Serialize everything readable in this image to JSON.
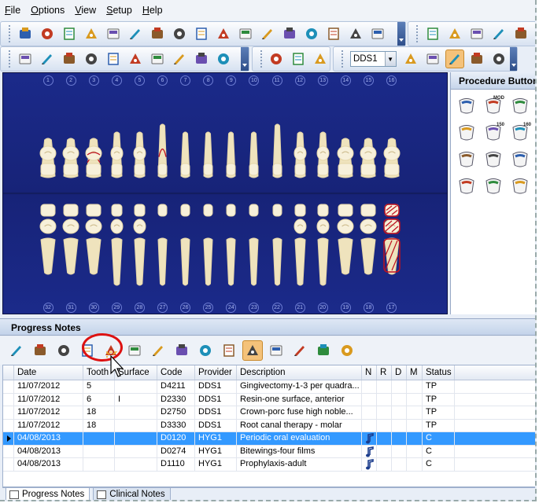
{
  "menu": [
    "File",
    "Options",
    "View",
    "Setup",
    "Help"
  ],
  "toolbar": {
    "provider": "DDS1"
  },
  "icons": {
    "row1": [
      "family-icon",
      "chart-icon",
      "book-icon",
      "chair-icon",
      "camera-icon",
      "pen-icon",
      "card-icon",
      "card2-icon",
      "clock-card-icon",
      "at-card-icon",
      "grid-icon",
      "cup-icon",
      "pencil-paper-icon",
      "door-icon",
      "dollar-icon",
      "glasses-icon",
      "xx-icon"
    ],
    "row1b": [
      "person-icon",
      "cross-icon",
      "medic-icon",
      "tablet-icon",
      "globe-icon"
    ],
    "row2": [
      "refresh-icon",
      "printer-icon",
      "fax-icon",
      "check-icon",
      "probe-icon",
      "syringe-icon",
      "xray-icon",
      "paper-icon",
      "loop-icon",
      "mouth-icon"
    ],
    "row2b": [
      "tooth-tool-icon",
      "implant-icon",
      "tooth-star-icon"
    ],
    "row2c": [
      "eo-icon",
      "ortho-icon",
      "tooth-active-icon",
      "check-circle-icon",
      "pane-icon"
    ]
  },
  "chart": {
    "upper_numbers": [
      "1",
      "2",
      "3",
      "4",
      "5",
      "6",
      "7",
      "8",
      "9",
      "10",
      "11",
      "12",
      "13",
      "14",
      "15",
      "16"
    ],
    "lower_numbers": [
      "32",
      "31",
      "30",
      "29",
      "28",
      "27",
      "26",
      "25",
      "24",
      "23",
      "22",
      "21",
      "20",
      "19",
      "18",
      "17"
    ],
    "accent": "#c0101e"
  },
  "procedure_panel": {
    "title": "Procedure Buttons",
    "buttons": [
      "crown-icon",
      "mod-icon",
      "onlay-icon",
      "endo-icon",
      "post-150-icon",
      "post-160-icon",
      "sealant-icon",
      "xray-pano-icon",
      "xray-bw-icon",
      "denture-upper-icon",
      "denture-lower-icon",
      "document-w-icon"
    ],
    "labels": [
      "MOD",
      "150",
      "160"
    ]
  },
  "progress_notes": {
    "title": "Progress Notes",
    "toolbar_icons": [
      "check-circle-icon",
      "trash-icon",
      "tools-icon",
      "printer-icon",
      "tooth-person-icon",
      "search-icon",
      "import-icon",
      "d-icon",
      "tick-icon",
      "e-icon",
      "tooth-active-icon",
      "phone-icon",
      "transfer-icon",
      "window-icon",
      "calculator-icon"
    ],
    "columns": [
      "Date",
      "Tooth",
      "Surface",
      "Code",
      "Provider",
      "Description",
      "N",
      "R",
      "D",
      "M",
      "Status"
    ],
    "rows": [
      {
        "date": "11/07/2012",
        "tooth": "5",
        "surface": "",
        "code": "D4211",
        "provider": "DDS1",
        "description": "Gingivectomy-1-3 per quadra...",
        "n": "",
        "status": "TP"
      },
      {
        "date": "11/07/2012",
        "tooth": "6",
        "surface": "I",
        "code": "D2330",
        "provider": "DDS1",
        "description": "Resin-one surface, anterior",
        "n": "",
        "status": "TP"
      },
      {
        "date": "11/07/2012",
        "tooth": "18",
        "surface": "",
        "code": "D2750",
        "provider": "DDS1",
        "description": "Crown-porc fuse high noble...",
        "n": "",
        "status": "TP"
      },
      {
        "date": "11/07/2012",
        "tooth": "18",
        "surface": "",
        "code": "D3330",
        "provider": "DDS1",
        "description": "Root canal therapy - molar",
        "n": "",
        "status": "TP"
      },
      {
        "date": "04/08/2013",
        "tooth": "",
        "surface": "",
        "code": "D0120",
        "provider": "HYG1",
        "description": "Periodic oral evaluation",
        "n": "note",
        "status": "C"
      },
      {
        "date": "04/08/2013",
        "tooth": "",
        "surface": "",
        "code": "D0274",
        "provider": "HYG1",
        "description": "Bitewings-four films",
        "n": "note",
        "status": "C"
      },
      {
        "date": "04/08/2013",
        "tooth": "",
        "surface": "",
        "code": "D1110",
        "provider": "HYG1",
        "description": "Prophylaxis-adult",
        "n": "note",
        "status": "C"
      }
    ],
    "selected_row": 4
  },
  "tabs": [
    "Progress Notes",
    "Clinical Notes"
  ]
}
